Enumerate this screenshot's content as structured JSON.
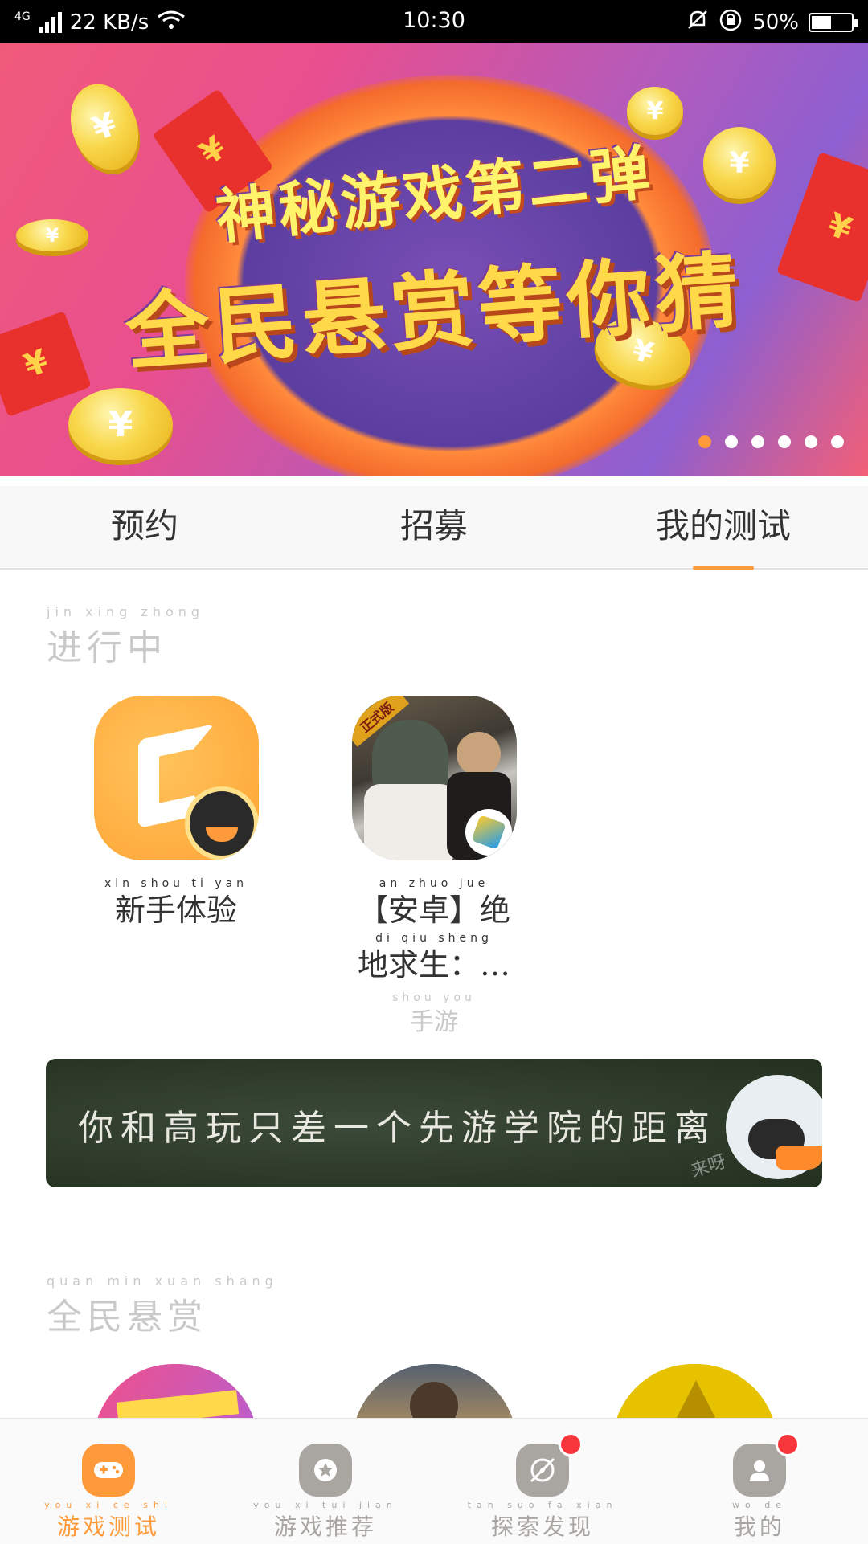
{
  "status_bar": {
    "network": "4G",
    "speed": "22 KB/s",
    "time": "10:30",
    "battery": "50%",
    "battery_level": 0.5
  },
  "banner": {
    "headline": "神秘游戏第二弹",
    "subheadline": "全民悬赏等你猜",
    "coin_symbol": "¥",
    "page_count": 6,
    "active_page": 1
  },
  "tabs": [
    {
      "label": "预约",
      "active": false
    },
    {
      "label": "招募",
      "active": false
    },
    {
      "label": "我的测试",
      "active": true
    }
  ],
  "sections": {
    "ongoing": {
      "pinyin": "jin xing zhong",
      "title": "进行中"
    },
    "bounty": {
      "pinyin": "quan min xuan shang",
      "title": "全民悬赏"
    }
  },
  "games": [
    {
      "name_pinyin": "xin shou ti yan",
      "name": "新手体验",
      "name_line2_pinyin": "",
      "name_line2": "",
      "sub_pinyin": "",
      "sub": "",
      "icon": "gamecenter-logo-icon"
    },
    {
      "name_pinyin": "an zhuo jue",
      "name": "【安卓】绝",
      "name_line2_pinyin": "di qiu sheng",
      "name_line2": "地求生：…",
      "sub_pinyin": "shou you",
      "sub": "手游",
      "icon": "pubg-game-icon",
      "tag": "正式版"
    }
  ],
  "promo_banner": {
    "text": "你和高玩只差一个先游学院的距离",
    "stamp": "来呀"
  },
  "bottom_nav": [
    {
      "pinyin": "you xi ce shi",
      "label": "游戏测试",
      "icon": "gamepad-icon",
      "active": true,
      "badge": false
    },
    {
      "pinyin": "you xi tui jian",
      "label": "游戏推荐",
      "icon": "star-icon",
      "active": false,
      "badge": false
    },
    {
      "pinyin": "tan suo fa xian",
      "label": "探索发现",
      "icon": "compass-icon",
      "active": false,
      "badge": true
    },
    {
      "pinyin": "wo de",
      "label": "我的",
      "icon": "user-icon",
      "active": false,
      "badge": true
    }
  ],
  "colors": {
    "accent": "#ff9a3a",
    "inactive": "#a9a6a2",
    "badge": "#f8373c"
  }
}
